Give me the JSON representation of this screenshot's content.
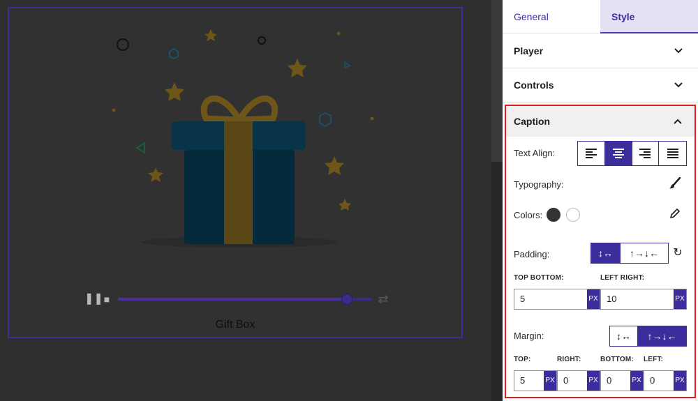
{
  "tabs": {
    "general": "General",
    "style": "Style"
  },
  "accordion": {
    "player": "Player",
    "controls": "Controls",
    "caption": "Caption"
  },
  "preview": {
    "caption_text": "Gift Box",
    "progress_percent": 90
  },
  "caption_panel": {
    "text_align_label": "Text Align:",
    "typography_label": "Typography:",
    "colors_label": "Colors:",
    "colors": [
      "#333333",
      "#ffffff"
    ],
    "padding": {
      "label": "Padding:",
      "mode_linked": "↕↔",
      "mode_individual": "↑→↓←",
      "top_bottom_label": "TOP BOTTOM:",
      "left_right_label": "LEFT RIGHT:",
      "top_bottom_value": "5",
      "left_right_value": "10",
      "unit": "PX"
    },
    "margin": {
      "label": "Margin:",
      "mode_linked": "↕↔",
      "mode_individual": "↑→↓←",
      "top_label": "TOP:",
      "right_label": "RIGHT:",
      "bottom_label": "BOTTOM:",
      "left_label": "LEFT:",
      "top_value": "5",
      "right_value": "0",
      "bottom_value": "0",
      "left_value": "0",
      "unit": "PX"
    }
  },
  "icons": {
    "chevron_down": "⌄",
    "chevron_up": "⌃",
    "pause": "❚❚",
    "stop": "■",
    "loop": "⇄",
    "brush": "🖌",
    "pencil": "✎",
    "reset": "↻"
  },
  "colors": {
    "accent": "#3b2d9c",
    "highlight_border": "#e21b1b"
  }
}
